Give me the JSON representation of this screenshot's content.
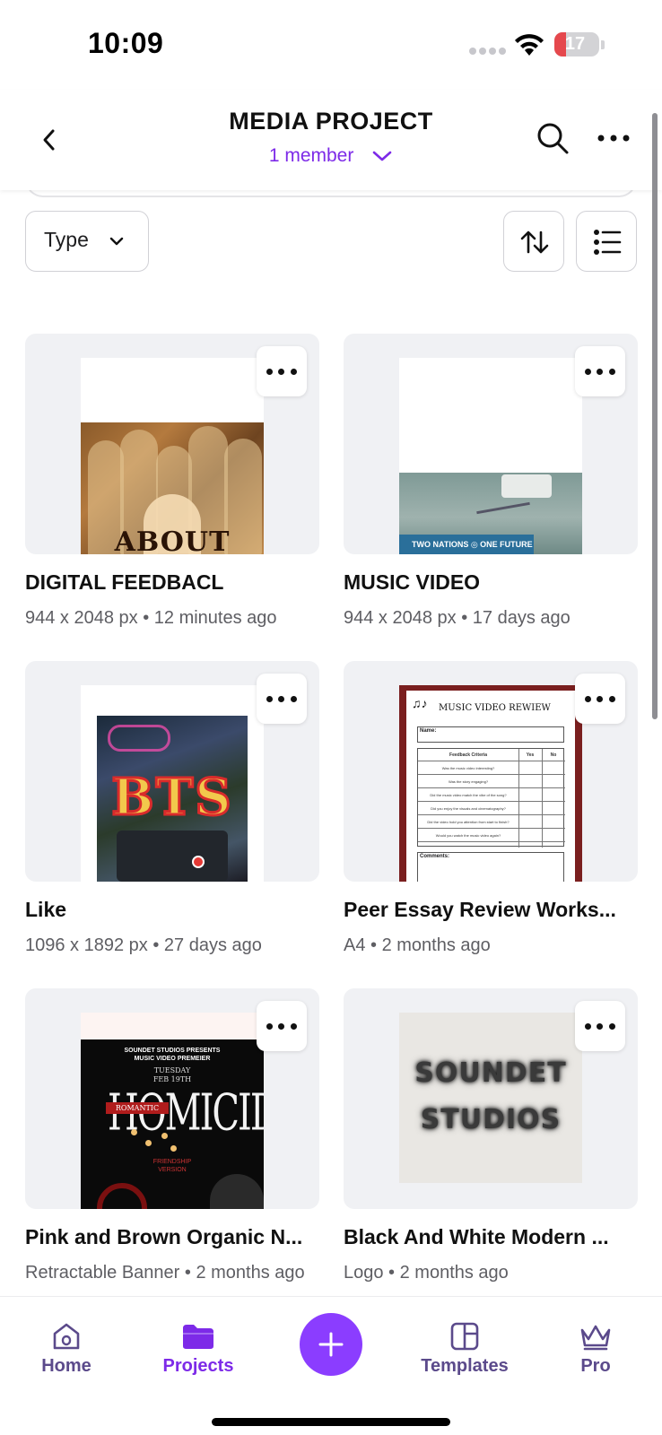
{
  "status_bar": {
    "time": "10:09",
    "battery": "17"
  },
  "header": {
    "title": "MEDIA PROJECT",
    "members": "1 member"
  },
  "filters": {
    "type_label": "Type"
  },
  "cards": [
    {
      "title": "DIGITAL FEEDBACL",
      "meta": "944 x 2048 px • 12 minutes ago",
      "thumb_text": "ABOUT"
    },
    {
      "title": "MUSIC VIDEO",
      "meta": "944 x 2048 px • 17 days ago",
      "thumb_text": "TWO NATIONS ◎ ONE FUTURE"
    },
    {
      "title": "Like",
      "meta": "1096 x 1892 px • 27 days ago",
      "thumb_text": "BTS"
    },
    {
      "title": "Peer Essay Review Works...",
      "meta": "A4 • 2 months ago",
      "thumb_text": "MUSIC VIDEO REWIEW"
    },
    {
      "title": "Pink and Brown Organic N...",
      "meta": "Retractable Banner • 2 months ago",
      "thumb_text": "HOMICIDE"
    },
    {
      "title": "Black And White Modern ...",
      "meta": "Logo • 2 months ago",
      "thumb_text": "SOUNDET STUDIOS"
    }
  ],
  "rubric": {
    "name_label": "Name:",
    "header": "Feedback Criteria",
    "yes": "Yes",
    "no": "No",
    "rows": [
      "Was the music video interesting?",
      "Was the story engaging?",
      "Did the music video match the vibe of the song?",
      "Did you enjoy the visuals and cinematography?",
      "Did the video hold you attention from start to finish?",
      "Would you watch the music video again?"
    ],
    "comments_label": "Comments:"
  },
  "poster": {
    "head": "SOUNDET STUDIOS PRESENTS\nMUSIC VIDEO PREMEIER",
    "date": "TUESDAY\nFEB 19TH",
    "romantic": "ROMANTIC",
    "version": "FRIENDSHIP\nVERSION"
  },
  "bottom_nav": {
    "home": "Home",
    "projects": "Projects",
    "templates": "Templates",
    "pro": "Pro"
  },
  "colors": {
    "accent": "#7d2ae8",
    "fab": "#8b3dff"
  },
  "icons": [
    "back-icon",
    "search-icon",
    "more-icon",
    "chevron-down-icon",
    "sort-icon",
    "list-view-icon",
    "dots-icon",
    "home-icon",
    "folder-icon",
    "plus-icon",
    "templates-icon",
    "crown-icon"
  ]
}
